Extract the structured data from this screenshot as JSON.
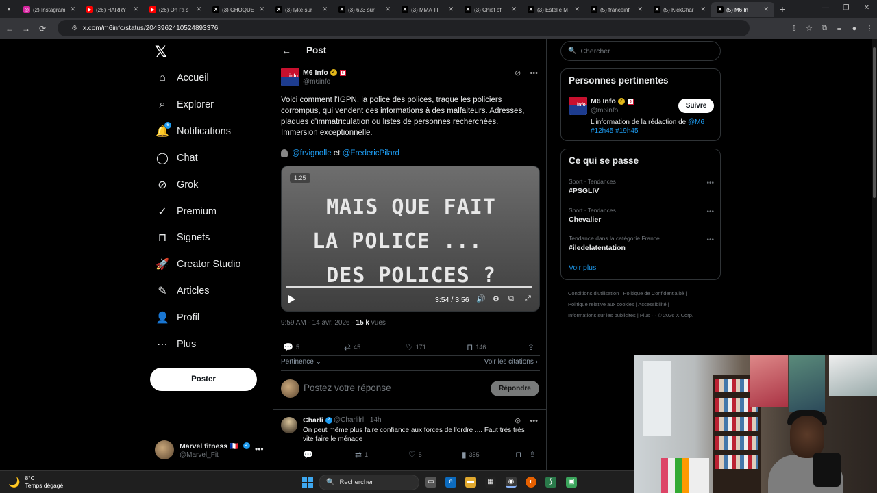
{
  "browser": {
    "tabs": [
      {
        "title": "(2) Instagram",
        "icon": "instagram-icon",
        "color": "#d6249f"
      },
      {
        "title": "(26) HARRY",
        "icon": "youtube-icon",
        "color": "#ff0000"
      },
      {
        "title": "(26) On l'a s",
        "icon": "youtube-icon",
        "color": "#ff0000"
      },
      {
        "title": "(3) CHOQUE",
        "icon": "x-icon",
        "color": "#000000"
      },
      {
        "title": "(3) lyke sur",
        "icon": "x-icon",
        "color": "#000000"
      },
      {
        "title": "(3) 623 sur",
        "icon": "x-icon",
        "color": "#000000"
      },
      {
        "title": "(3) MMA TI",
        "icon": "x-icon",
        "color": "#000000"
      },
      {
        "title": "(3) Chief of",
        "icon": "x-icon",
        "color": "#000000"
      },
      {
        "title": "(3) Estelle M",
        "icon": "x-icon",
        "color": "#000000"
      },
      {
        "title": "(5) franceinf",
        "icon": "x-icon",
        "color": "#000000"
      },
      {
        "title": "(5) KickChar",
        "icon": "x-icon",
        "color": "#000000"
      },
      {
        "title": "(5) M6 In",
        "icon": "x-icon",
        "color": "#000000",
        "active": true
      }
    ],
    "url": "x.com/m6info/status/2043962410524893376"
  },
  "nav": {
    "items": [
      {
        "label": "Accueil",
        "icon": "home-icon"
      },
      {
        "label": "Explorer",
        "icon": "search-icon"
      },
      {
        "label": "Notifications",
        "icon": "bell-icon",
        "badge": "6"
      },
      {
        "label": "Chat",
        "icon": "chat-bubble-icon"
      },
      {
        "label": "Grok",
        "icon": "grok-icon"
      },
      {
        "label": "Premium",
        "icon": "verified-badge-icon"
      },
      {
        "label": "Signets",
        "icon": "bookmark-icon"
      },
      {
        "label": "Creator Studio",
        "icon": "rocket-icon"
      },
      {
        "label": "Articles",
        "icon": "article-edit-icon"
      },
      {
        "label": "Profil",
        "icon": "person-icon"
      },
      {
        "label": "Plus",
        "icon": "more-circle-icon"
      }
    ],
    "post_button": "Poster",
    "account": {
      "name": "Marvel fitness 🇫🇷",
      "handle": "@Marvel_Fit"
    }
  },
  "post": {
    "header": "Post",
    "author": "M6 Info",
    "handle": "@m6info",
    "text": "Voici comment l'IGPN, la police des polices, traque les policiers corrompus, qui vendent des informations à des malfaiteurs. Adresses, plaques d'immatriculation ou listes de personnes recherchées. Immersion exceptionnelle.",
    "mention_1": "@frvignolle",
    "mention_joiner": "et",
    "mention_2": "@FredericPilard",
    "video": {
      "speed": "1.25",
      "line1": "MAIS QUE FAIT",
      "line2": "LA POLICE ...",
      "line3": "DES POLICES ?",
      "time": "3:54 / 3:56",
      "progress": 0.99
    },
    "timestamp": "9:59 AM · 14 avr. 2026 · ",
    "views_count": "15 k",
    "views_label": " vues",
    "stats": {
      "replies": "5",
      "reposts": "45",
      "likes": "171",
      "bookmarks": "146"
    },
    "sort_label": "Pertinence",
    "citations_label": "Voir les citations",
    "reply_placeholder": "Postez votre réponse",
    "reply_button": "Répondre"
  },
  "comment": {
    "name": "Charli",
    "meta": "@Charlilrl · 14h",
    "text": "On peut même plus faire confiance aux forces de l'ordre .... Faut très très vite faire le ménage",
    "stats": {
      "replies": "",
      "reposts": "1",
      "likes": "5",
      "views": "355"
    }
  },
  "sidebar": {
    "search_placeholder": "Chercher",
    "relevant_title": "Personnes pertinentes",
    "relevant": {
      "name": "M6 Info",
      "handle": "@m6info",
      "follow": "Suivre",
      "bio_prefix": "L'information de la rédaction de ",
      "bio_link1": "@M6",
      "bio_link2": "#12h45",
      "bio_link3": "#19h45"
    },
    "trends_title": "Ce qui se passe",
    "trends": [
      {
        "category": "Sport · Tendances",
        "name": "#PSGLIV"
      },
      {
        "category": "Sport · Tendances",
        "name": "Chevalier"
      },
      {
        "category": "Tendance dans la catégorie France",
        "name": "#iledelatentation"
      }
    ],
    "see_more": "Voir plus",
    "footer": {
      "line1": "Conditions d'utilisation  |  Politique de Confidentialité  |",
      "line2": "Politique relative aux cookies  |  Accessibilité  |",
      "line3": "Informations sur les publicités  |  Plus ···  © 2026 X Corp."
    }
  },
  "taskbar": {
    "temp": "8°C",
    "weather": "Temps dégagé",
    "search": "Rechercher"
  }
}
